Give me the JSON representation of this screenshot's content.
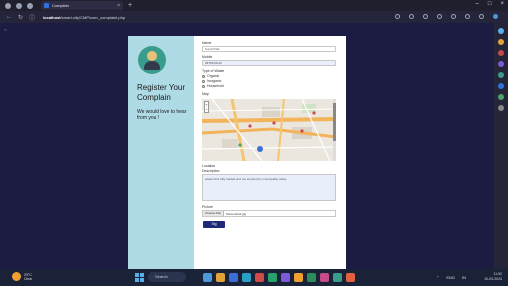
{
  "browser": {
    "tab_title": "Complain",
    "tab_close": "×",
    "new_tab": "+",
    "url_host": "localhost",
    "url_path": "/smart-city/CMP/user_complaint.php",
    "window_controls": [
      "–",
      "□",
      "×"
    ]
  },
  "left_panel": {
    "avatar_icon": "user-avatar-icon",
    "heading": "Register Your Complain",
    "subtext": "We would love to hear from you !"
  },
  "form": {
    "name_label": "Name",
    "name_value": "Kunal Patil",
    "mobile_label": "Mobile",
    "mobile_value": "9876543210",
    "type_label": "Type of Waste",
    "type_options": [
      "Organic",
      "Inorganic",
      "Household"
    ],
    "map_label": "Map",
    "map_zoom_in": "+",
    "map_zoom_out": "−",
    "location_label": "Location",
    "description_label": "Description",
    "description_value": "waste bins fully loaded and not emptied by municipality today",
    "picture_label": "Picture",
    "file_button": "Choose File",
    "file_name": "Screenshot.jpg",
    "submit_label": "Sig"
  },
  "taskbar": {
    "weather_temp": "29°C",
    "weather_desc": "Clear",
    "search_label": "Search",
    "tray_lang": "ENG",
    "tray_region": "IN",
    "time": "11:52",
    "date": "10-03-2024"
  },
  "colors": {
    "page_bg": "#1c1b41",
    "left_panel": "#aedbe6",
    "submit": "#1e2a78",
    "avatar_bg": "#3a9c8c"
  }
}
